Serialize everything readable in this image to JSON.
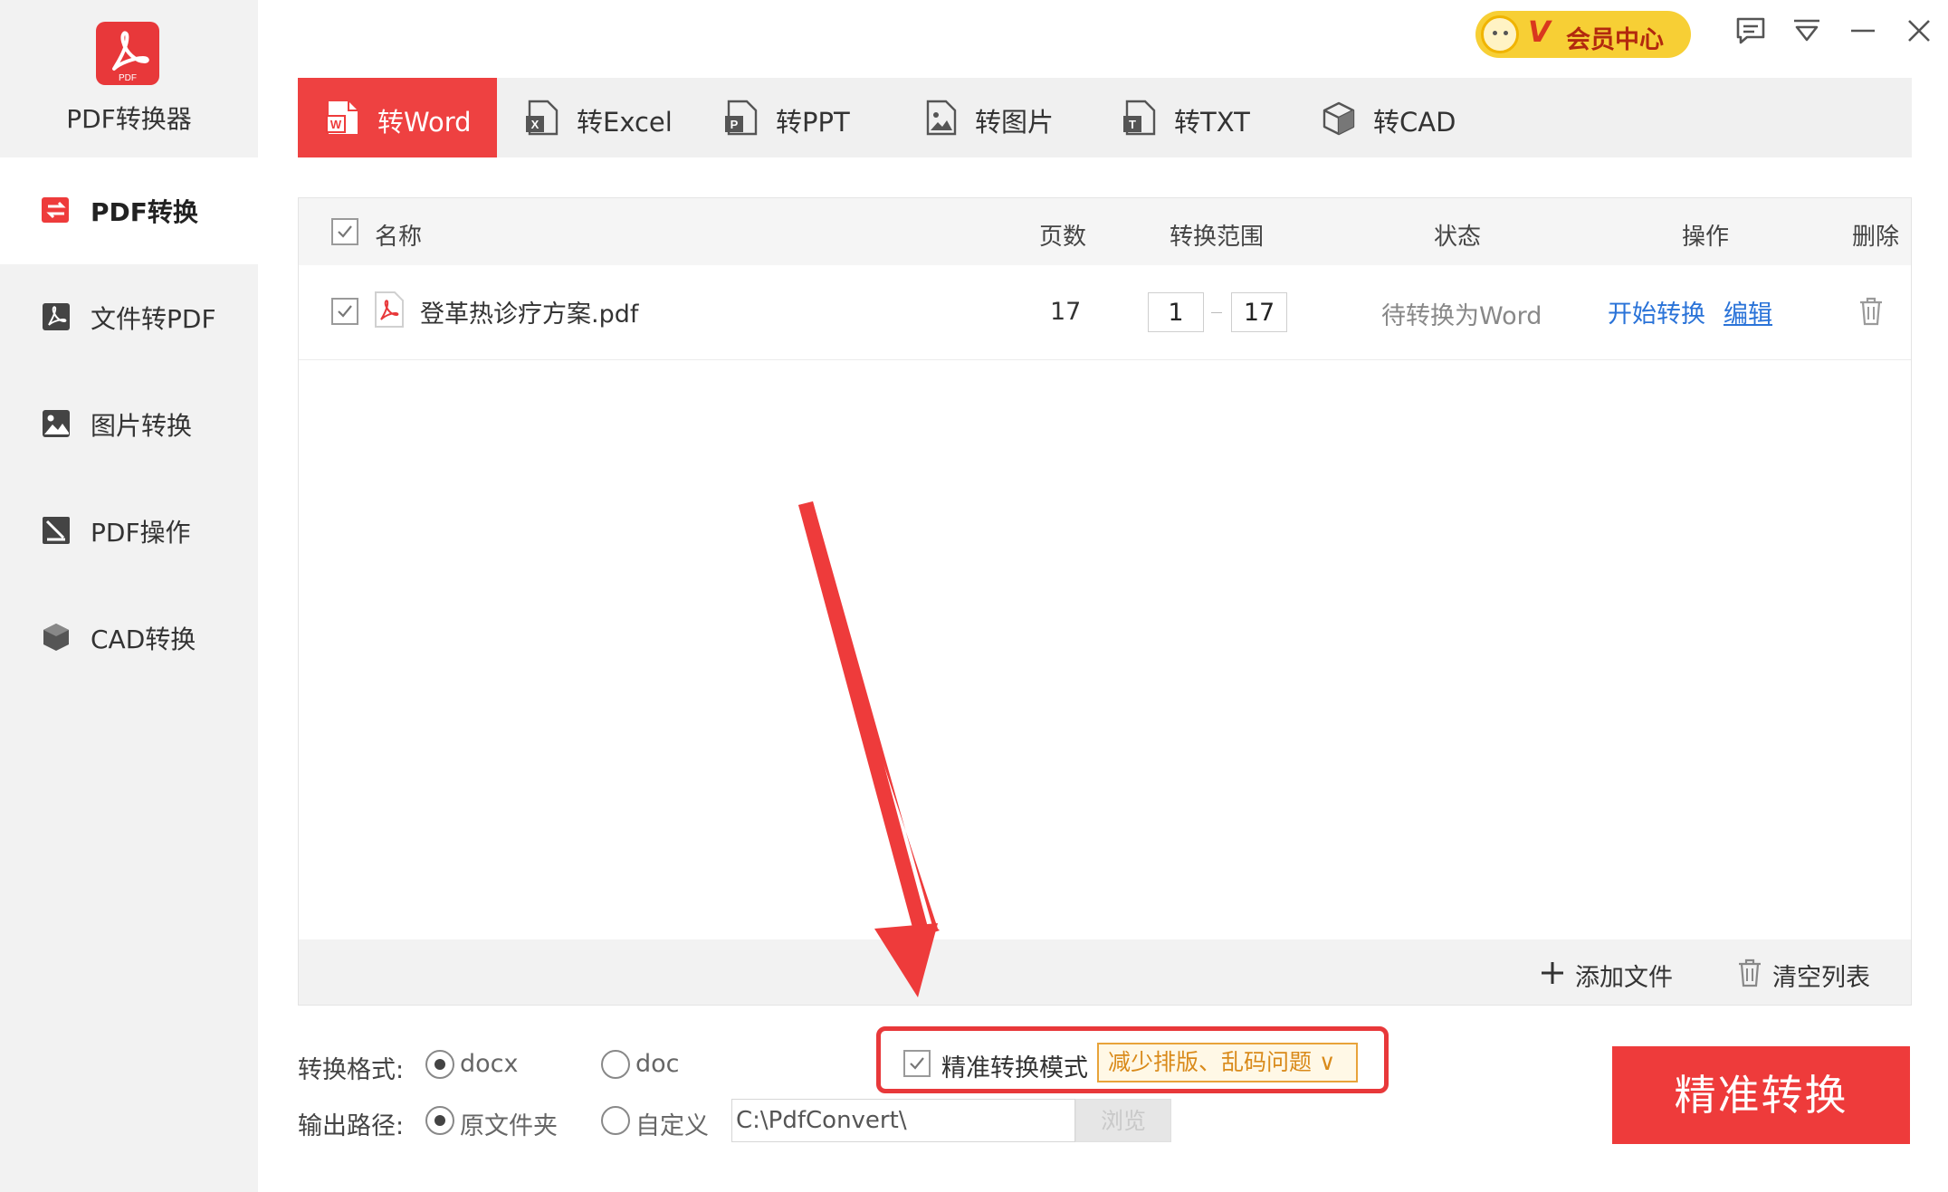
{
  "app": {
    "name": "PDF转换器",
    "logo_caption": "PDF"
  },
  "sidebar": {
    "items": [
      {
        "label": "PDF转换",
        "icon": "convert-icon",
        "active": true
      },
      {
        "label": "文件转PDF",
        "icon": "pdf-icon",
        "active": false
      },
      {
        "label": "图片转换",
        "icon": "image-icon",
        "active": false
      },
      {
        "label": "PDF操作",
        "icon": "edit-icon",
        "active": false
      },
      {
        "label": "CAD转换",
        "icon": "cube-icon",
        "active": false
      }
    ]
  },
  "titlebar": {
    "vip_letter": "V",
    "vip_label": "会员中心",
    "icons": [
      "message-icon",
      "menu-icon",
      "minimize-icon",
      "close-icon"
    ]
  },
  "tabs": [
    {
      "label": "转Word",
      "icon": "word-icon",
      "active": true
    },
    {
      "label": "转Excel",
      "icon": "excel-icon",
      "active": false
    },
    {
      "label": "转PPT",
      "icon": "ppt-icon",
      "active": false
    },
    {
      "label": "转图片",
      "icon": "image-icon",
      "active": false
    },
    {
      "label": "转TXT",
      "icon": "txt-icon",
      "active": false
    },
    {
      "label": "转CAD",
      "icon": "cad-icon",
      "active": false
    }
  ],
  "table": {
    "headers": {
      "name": "名称",
      "pages": "页数",
      "range": "转换范围",
      "status": "状态",
      "action": "操作",
      "delete": "删除"
    },
    "rows": [
      {
        "checked": true,
        "file_name": "登革热诊疗方案.pdf",
        "pages": "17",
        "range_from": "1",
        "range_to": "17",
        "status": "待转换为Word",
        "action_start": "开始转换",
        "action_edit": "编辑"
      }
    ],
    "footer": {
      "add_file": "添加文件",
      "clear_list": "清空列表"
    }
  },
  "options": {
    "format_label": "转换格式:",
    "format_docx": "docx",
    "format_doc": "doc",
    "format_selected": "docx",
    "output_label": "输出路径:",
    "output_source": "原文件夹",
    "output_custom": "自定义",
    "output_selected": "原文件夹",
    "path_value": "C:\\PdfConvert\\",
    "browse_label": "浏览",
    "precise_mode_label": "精准转换模式",
    "precise_mode_checked": true,
    "precise_badge": "减少排版、乱码问题 ∨",
    "convert_button": "精准转换"
  },
  "colors": {
    "accent_red": "#ee3b3b",
    "link_blue": "#2a73d8",
    "vip_yellow": "#f7cf35",
    "badge_orange": "#d98a1a"
  }
}
